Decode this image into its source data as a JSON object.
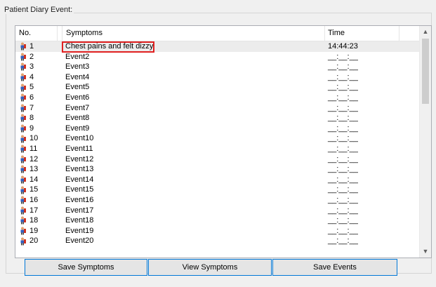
{
  "group": {
    "title": "Patient Diary Event:"
  },
  "table": {
    "columns": {
      "no": "No.",
      "symptoms": "Symptoms",
      "time": "Time"
    },
    "rows": [
      {
        "no": "1",
        "symptom": "Chest pains and felt dizzy",
        "time": "14:44:23"
      },
      {
        "no": "2",
        "symptom": "Event2",
        "time": "__:__:__"
      },
      {
        "no": "3",
        "symptom": "Event3",
        "time": "__:__:__"
      },
      {
        "no": "4",
        "symptom": "Event4",
        "time": "__:__:__"
      },
      {
        "no": "5",
        "symptom": "Event5",
        "time": "__:__:__"
      },
      {
        "no": "6",
        "symptom": "Event6",
        "time": "__:__:__"
      },
      {
        "no": "7",
        "symptom": "Event7",
        "time": "__:__:__"
      },
      {
        "no": "8",
        "symptom": "Event8",
        "time": "__:__:__"
      },
      {
        "no": "9",
        "symptom": "Event9",
        "time": "__:__:__"
      },
      {
        "no": "10",
        "symptom": "Event10",
        "time": "__:__:__"
      },
      {
        "no": "11",
        "symptom": "Event11",
        "time": "__:__:__"
      },
      {
        "no": "12",
        "symptom": "Event12",
        "time": "__:__:__"
      },
      {
        "no": "13",
        "symptom": "Event13",
        "time": "__:__:__"
      },
      {
        "no": "14",
        "symptom": "Event14",
        "time": "__:__:__"
      },
      {
        "no": "15",
        "symptom": "Event15",
        "time": "__:__:__"
      },
      {
        "no": "16",
        "symptom": "Event16",
        "time": "__:__:__"
      },
      {
        "no": "17",
        "symptom": "Event17",
        "time": "__:__:__"
      },
      {
        "no": "18",
        "symptom": "Event18",
        "time": "__:__:__"
      },
      {
        "no": "19",
        "symptom": "Event19",
        "time": "__:__:__"
      },
      {
        "no": "20",
        "symptom": "Event20",
        "time": "__:__:__"
      }
    ],
    "selected_row": 0
  },
  "buttons": {
    "save_symptoms": "Save Symptoms",
    "view_symptoms": "View Symptoms",
    "save_events": "Save Events"
  },
  "icons": {
    "row_icon": "person-icon"
  },
  "colors": {
    "highlight": "#e02020",
    "focus_border": "#0078d7"
  }
}
